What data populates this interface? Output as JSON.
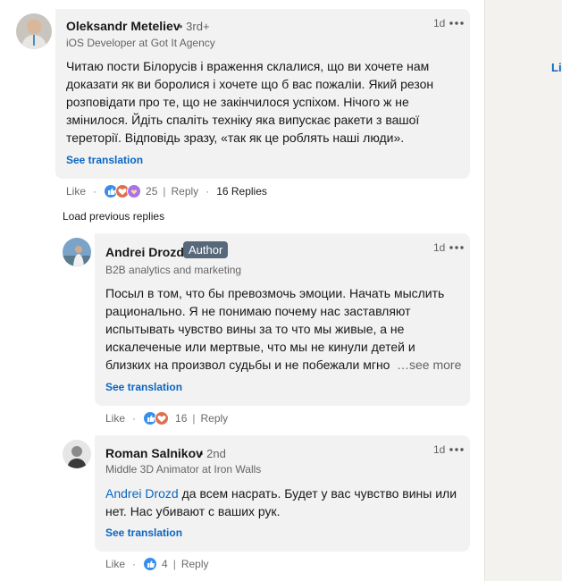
{
  "right_rail": {
    "link": "Lin"
  },
  "comments": [
    {
      "name": "Oleksandr Meteliev",
      "degree": "• 3rd+",
      "headline": "iOS Developer at Got It Agency",
      "time": "1d",
      "text_lines": [
        "Читаю пости Білорусів і враження склалися, що ви хочете нам",
        "доказати як ви боролися і хочете що б вас пожаліи. Який резон",
        "розповідати про те, що не закінчилося успіхом. Нічого ж не",
        "змінилося. Йдіть спаліть техніку яка випускає ракети з вашої",
        "тереторії. Відповідь зразу, «так як це роблять наші люди»."
      ],
      "see_translation": "See translation",
      "like": "Like",
      "reaction_count": "25",
      "reply": "Reply",
      "replies": "16 Replies"
    }
  ],
  "load_previous": "Load previous replies",
  "replies": [
    {
      "name": "Andrei Drozd",
      "badge": "Author",
      "headline": "B2B analytics and marketing",
      "time": "1d",
      "text_lines": [
        "Посыл в том, что бы превозмочь эмоции. Начать мыслить",
        "рационально. Я не понимаю почему нас заставляют",
        "испытывать чувство вины за то что мы живые, а не",
        "искалеченые или мертвые, что мы не кинули детей и",
        "близких на произвол судьбы и не побежали мгно"
      ],
      "see_more": "…see more",
      "see_translation": "See translation",
      "like": "Like",
      "reaction_count": "16",
      "reply": "Reply"
    },
    {
      "name": "Roman Salnikov",
      "degree": "• 2nd",
      "headline": "Middle 3D Animator at Iron Walls",
      "time": "1d",
      "mention": "Andrei Drozd",
      "text_line1_rest": " да всем насрать. Будет у вас чувство вины или",
      "text_line2": "нет. Нас убивают с ваших рук.",
      "see_translation": "See translation",
      "like": "Like",
      "reaction_count": "4",
      "reply": "Reply"
    }
  ],
  "colors": {
    "link": "#0a66c2",
    "bubble": "#f2f2f2",
    "badge": "#56687a",
    "like_blue": "#378fe9",
    "love_red": "#df704d",
    "support_purple": "#a872e8"
  },
  "icons": [
    "like-reaction-icon",
    "love-reaction-icon",
    "support-reaction-icon",
    "more-options-icon"
  ]
}
